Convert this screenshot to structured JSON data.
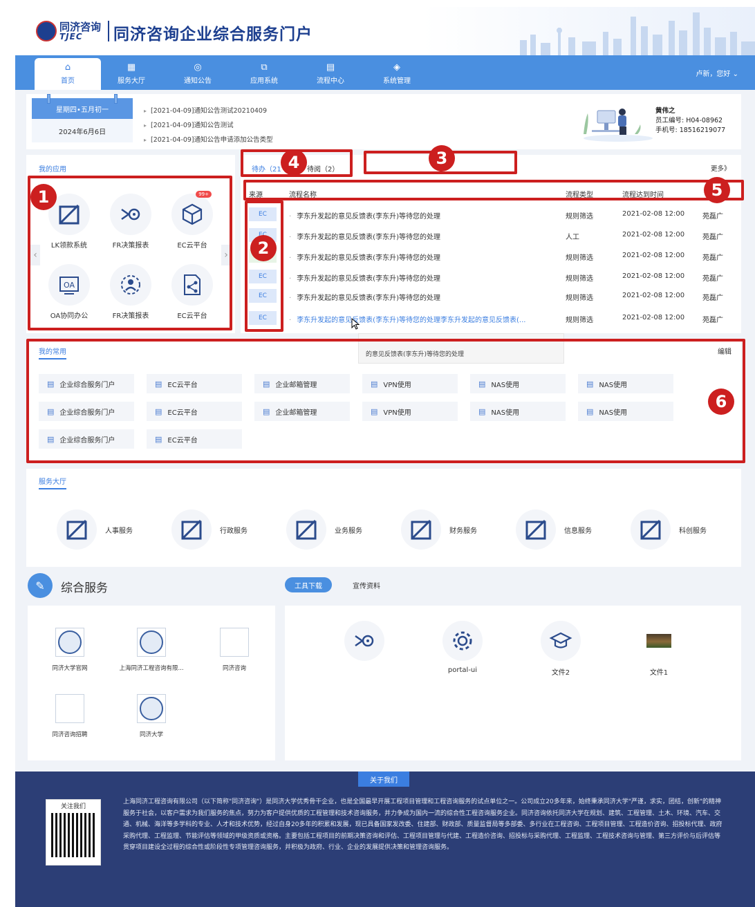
{
  "header": {
    "logo_cn": "同济咨询",
    "logo_en": "TJEC",
    "title": "同济咨询企业综合服务门户"
  },
  "nav": {
    "items": [
      {
        "label": "首页",
        "icon": "⌂"
      },
      {
        "label": "服务大厅",
        "icon": "▦"
      },
      {
        "label": "通知公告",
        "icon": "◎"
      },
      {
        "label": "应用系统",
        "icon": "⧉"
      },
      {
        "label": "流程中心",
        "icon": "▤"
      },
      {
        "label": "系统管理",
        "icon": "◈"
      }
    ],
    "user": "卢新，您好 ⌄"
  },
  "calendar": {
    "weekday_lunar": "星期四•五月初一",
    "date": "2024年6月6日"
  },
  "notices": [
    "[2021-04-09]通知公告测试20210409",
    "[2021-04-09]通知公告测试",
    "[2021-04-09]通知公告申请添加公告类型"
  ],
  "profile": {
    "name": "黄伟之",
    "employee_id": "员工编号: H04-08962",
    "phone": "手机号: 18516219077"
  },
  "my_apps": {
    "title": "我的应用",
    "apps": [
      {
        "label": "LK领款系统",
        "icon": "lk-icon"
      },
      {
        "label": "FR决策报表",
        "icon": "fr-icon"
      },
      {
        "label": "EC云平台",
        "icon": "cube-icon",
        "badge": "99+"
      },
      {
        "label": "OA协同办公",
        "icon": "oa-icon"
      },
      {
        "label": "FR决策报表",
        "icon": "people-icon"
      },
      {
        "label": "EC云平台",
        "icon": "doc-share-icon"
      }
    ]
  },
  "tasks": {
    "tab_todo": "待办（21",
    "tab_read": "待阅（2）",
    "more": "更多》",
    "columns": [
      "来源",
      "流程名称",
      "流程类型",
      "流程达到时间"
    ],
    "rows": [
      {
        "src": "EC",
        "name": "李东升发起的意见反馈表(李东升)等待您的处理",
        "type": "规则筛选",
        "time": "2021-02-08 12:00",
        "owner": "苑磊广"
      },
      {
        "src": "EC",
        "name": "李东升发起的意见反馈表(李东升)等待您的处理",
        "type": "人工",
        "time": "2021-02-08 12:00",
        "owner": "苑磊广"
      },
      {
        "src": "",
        "name": "李东升发起的意见反馈表(李东升)等待您的处理",
        "type": "规则筛选",
        "time": "2021-02-08 12:00",
        "owner": "苑磊广"
      },
      {
        "src": "EC",
        "name": "李东升发起的意见反馈表(李东升)等待您的处理",
        "type": "规则筛选",
        "time": "2021-02-08 12:00",
        "owner": "苑磊广"
      },
      {
        "src": "EC",
        "name": "李东升发起的意见反馈表(李东升)等待您的处理",
        "type": "规则筛选",
        "time": "2021-02-08 12:00",
        "owner": "苑磊广"
      },
      {
        "src": "EC",
        "name": "李东升发起的意见反馈表(李东升)等待您的处理李东升发起的意见反馈表(...",
        "type": "规则筛选",
        "time": "2021-02-08 12:00",
        "owner": "苑磊广"
      }
    ],
    "tooltip": "的意见反馈表(李东升)等待您的处理"
  },
  "favorites": {
    "title": "我的常用",
    "edit": "编辑",
    "items": [
      "企业综合服务门户",
      "EC云平台",
      "企业邮箱管理",
      "VPN使用",
      "NAS使用",
      "NAS使用",
      "企业综合服务门户",
      "EC云平台",
      "企业邮箱管理",
      "VPN使用",
      "NAS使用",
      "NAS使用",
      "企业综合服务门户",
      "EC云平台"
    ]
  },
  "service_hall": {
    "title": "服务大厅",
    "items": [
      "人事服务",
      "行政服务",
      "业务服务",
      "财务服务",
      "信息服务",
      "科创服务"
    ]
  },
  "portal": {
    "title": "综合服务",
    "tab_tools": "工具下载",
    "tab_promo": "宣传资料",
    "links": [
      "同济大学官网",
      "上海同济工程咨询有限...",
      "同济咨询",
      "同济咨询招聘",
      "同济大学"
    ],
    "tools": [
      "",
      "portal-ui",
      "文件2",
      "文件1"
    ]
  },
  "footer": {
    "tab": "关于我们",
    "qr_title": "关注我们",
    "text": "上海同济工程咨询有限公司（以下简称\"同济咨询\"）是同济大学优秀骨干企业，也是全国最早开展工程项目管理和工程咨询服务的试点单位之一。公司成立20多年来，始终秉承同济大学\"严谨，求实，团结，创新\"的精神服务于社会，以客户需求为我们服务的焦点，努力为客户提供优质的工程管理和技术咨询服务，并力争成为国内一流的综合性工程咨询服务企业。同济咨询依托同济大学在规划、建筑、工程管理、土木、环境、汽车、交通、机械、海洋等多学科的专业、人才和技术优势，经过自身20多年的积累和发展，现已具备国家发改委、住建部、财政部、质量监督局等多部委、多行业在工程咨询、工程项目管理、工程造价咨询、招投标代理、政府采购代理、工程监理、节能评估等领域的甲级资质或资格。主要包括工程项目的前期决策咨询和评估、工程项目管理与代建、工程造价咨询、招投标与采购代理、工程监理、工程技术咨询与管理、第三方评价与后评估等贯穿项目建设全过程的综合性或阶段性专项管理咨询服务，并积极为政府、行业、企业的发展提供决策和管理咨询服务。"
  },
  "annotations": [
    "1",
    "2",
    "3",
    "4",
    "5",
    "6"
  ],
  "colors": {
    "primary": "#4a8fe0",
    "annotation": "#cc1f1f",
    "footer": "#2c3e76"
  }
}
